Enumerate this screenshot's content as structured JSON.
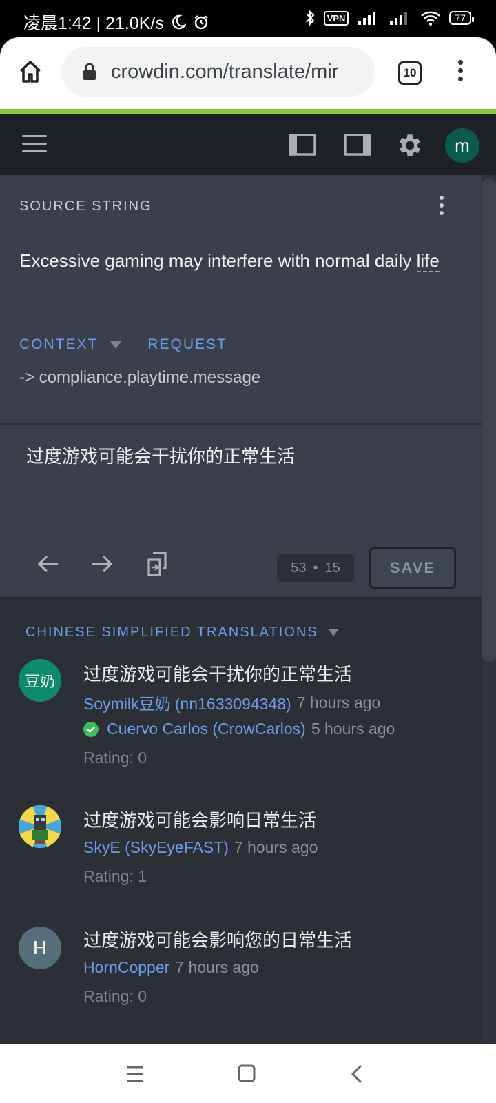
{
  "status_bar": {
    "left_text": "凌晨1:42 | 21.0K/s",
    "vpn_label": "VPN",
    "battery": "77"
  },
  "browser": {
    "url": "crowdin.com/translate/mir",
    "tab_count": "10"
  },
  "app_header": {
    "avatar_letter": "m"
  },
  "source": {
    "label": "SOURCE STRING",
    "text_main": "Excessive gaming may interfere with normal daily",
    "text_last": "life",
    "context_label": "CONTEXT",
    "request_label": "REQUEST",
    "context_value": "-> compliance.playtime.message"
  },
  "editor": {
    "text": "过度游戏可能会干扰你的正常生活",
    "count_source": "53",
    "count_sep": "•",
    "count_target": "15",
    "save_label": "SAVE"
  },
  "translations": {
    "header": "CHINESE SIMPLIFIED TRANSLATIONS",
    "items": [
      {
        "avatar_text": "豆奶",
        "text": "过度游戏可能会干扰你的正常生活",
        "author": "Soymilk豆奶 (nn1633094348)",
        "time": "7 hours ago",
        "approver": "Cuervo Carlos (CrowCarlos)",
        "approved_time": "5 hours ago",
        "rating": "Rating: 0"
      },
      {
        "avatar_text": "",
        "text": "过度游戏可能会影响日常生活",
        "author": "SkyE (SkyEyeFAST)",
        "time": "7 hours ago",
        "rating": "Rating: 1"
      },
      {
        "avatar_text": "H",
        "text": "过度游戏可能会影响您的日常生活",
        "author": "HornCopper",
        "time": "7 hours ago",
        "rating": "Rating: 0"
      }
    ]
  },
  "colors": {
    "accent_green": "#8dc63f",
    "link_blue": "#6a9de8",
    "panel_bg": "#3a3f4b",
    "list_bg": "#2c2f36",
    "header_bg": "#1e2126"
  }
}
